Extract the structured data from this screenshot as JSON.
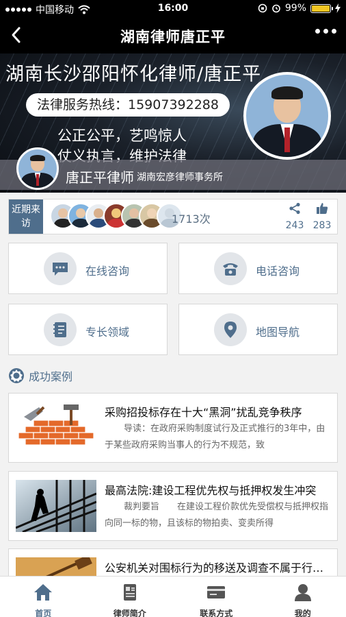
{
  "status_bar": {
    "carrier": "中国移动",
    "time": "16:00",
    "battery_percent": "99%",
    "battery_level": 0.99
  },
  "nav": {
    "title": "湖南律师唐正平"
  },
  "banner": {
    "headline": "湖南长沙邵阳怀化律师/唐正平",
    "hotline": "法律服务热线：15907392288",
    "slogan_line1": "公正公平，艺鸣惊人",
    "slogan_line2": "仗义执言，维护法律",
    "lawyer_name": "唐正平律师",
    "firm": "湖南宏彦律师事务所"
  },
  "visits": {
    "tag": "近期来访",
    "count": "1713次",
    "shares": "243",
    "likes": "283"
  },
  "tiles": {
    "online": "在线咨询",
    "phone": "电话咨询",
    "expertise": "专长领域",
    "map": "地图导航"
  },
  "section": {
    "title": "成功案例"
  },
  "articles": [
    {
      "title": "采购招投标存在十大“黑洞”扰乱竞争秩序",
      "summary": "导读：在政府采购制度试行及正式推行的3年中，由于某些政府采购当事人的行为不规范，致"
    },
    {
      "title": "最高法院:建设工程优先权与抵押权发生冲突",
      "summary": "裁判要旨　　在建设工程价款优先受偿权与抵押权指向同一标的物，且该标的物拍卖、变卖所得"
    },
    {
      "title": "公安机关对围标行为的移送及调查不属于行政诉讼",
      "summary": ""
    }
  ],
  "tabs": [
    {
      "label": "首页",
      "icon": "home-icon"
    },
    {
      "label": "律师简介",
      "icon": "profile-document-icon"
    },
    {
      "label": "联系方式",
      "icon": "contact-card-icon"
    },
    {
      "label": "我的",
      "icon": "user-icon"
    }
  ],
  "colors": {
    "accent": "#4f6e8c",
    "battery": "#f3c623"
  }
}
